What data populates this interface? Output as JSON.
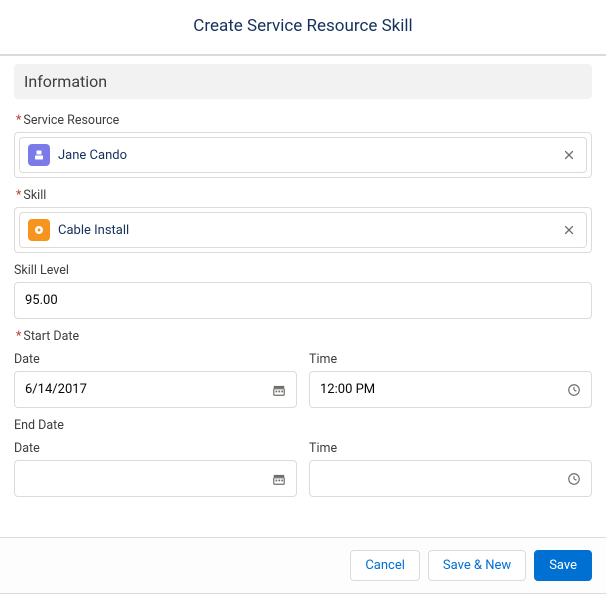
{
  "modal": {
    "title": "Create Service Resource Skill"
  },
  "section": {
    "information": "Information"
  },
  "labels": {
    "serviceResource": "Service Resource",
    "skill": "Skill",
    "skillLevel": "Skill Level",
    "startDate": "Start Date",
    "endDate": "End Date",
    "date": "Date",
    "time": "Time"
  },
  "values": {
    "serviceResource": "Jane Cando",
    "skill": "Cable Install",
    "skillLevel": "95.00",
    "startDate": "6/14/2017",
    "startTime": "12:00 PM",
    "endDate": "",
    "endTime": ""
  },
  "buttons": {
    "cancel": "Cancel",
    "saveNew": "Save & New",
    "save": "Save"
  },
  "icons": {
    "serviceResource": "resource-icon",
    "skill": "skill-icon"
  },
  "colors": {
    "primary": "#0070d2",
    "resourceIconBg": "#7a7ae8",
    "skillIconBg": "#f7941d",
    "required": "#c23934"
  }
}
